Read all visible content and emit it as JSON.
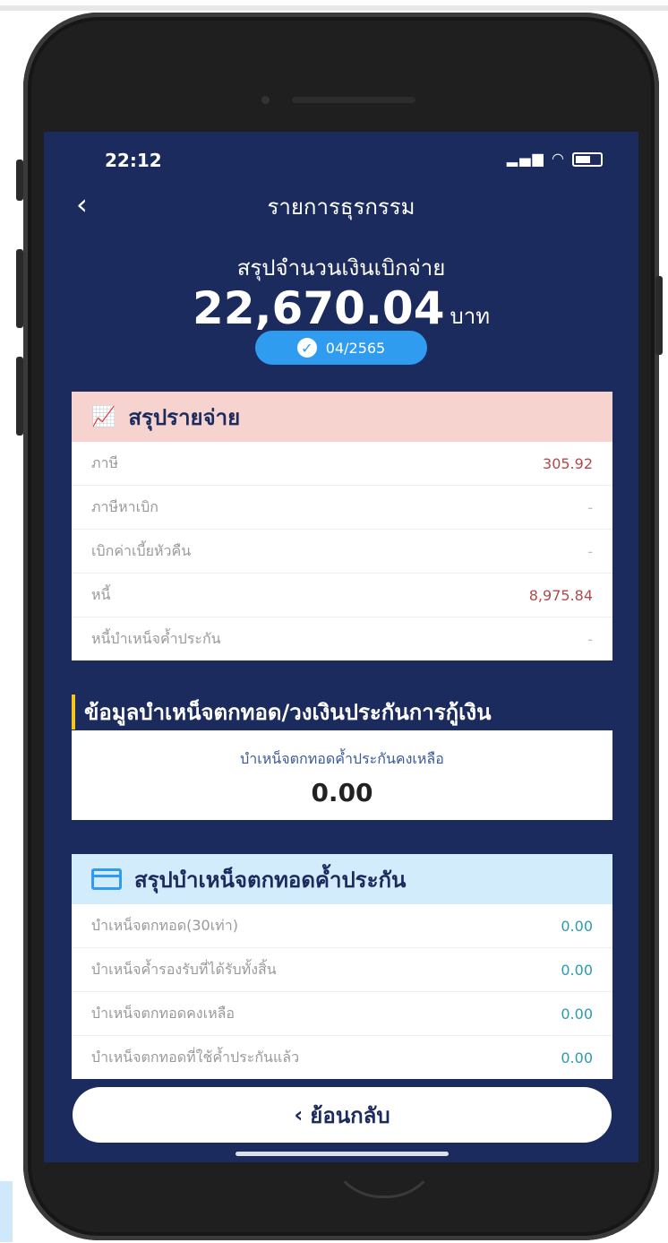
{
  "status_bar": {
    "time": "22:12",
    "icons": "signal wifi battery"
  },
  "header": {
    "title": "รายการธุรกรรม"
  },
  "summary": {
    "label": "สรุปจำนวนเงินเบิกจ่าย",
    "amount": "22,670.04",
    "unit": "บาท",
    "period": "04/2565"
  },
  "expense_card": {
    "title": "สรุปรายจ่าย",
    "icon": "chart-icon",
    "rows": [
      {
        "label": "ภาษี",
        "value": "305.92"
      },
      {
        "label": "ภาษีหาเบิก",
        "value": "-"
      },
      {
        "label": "เบิกค่าเบี้ยหัวคืน",
        "value": "-"
      },
      {
        "label": "หนี้",
        "value": "8,975.84"
      },
      {
        "label": "หนี้บำเหน็จค้ำประกัน",
        "value": "-"
      }
    ]
  },
  "section": {
    "title": "ข้อมูลบำเหน็จตกทอด/วงเงินประกันการกู้เงิน"
  },
  "balance": {
    "label": "บำเหน็จตกทอดค้ำประกันคงเหลือ",
    "value": "0.00"
  },
  "pension_card": {
    "title": "สรุปบำเหน็จตกทอดค้ำประกัน",
    "icon": "card-icon",
    "rows": [
      {
        "label": "บำเหน็จตกทอด(30เท่า)",
        "value": "0.00"
      },
      {
        "label": "บำเหน็จค้ำรองรับที่ได้รับทั้งสิ้น",
        "value": "0.00"
      },
      {
        "label": "บำเหน็จตกทอดคงเหลือ",
        "value": "0.00"
      },
      {
        "label": "บำเหน็จตกทอดที่ใช้ค้ำประกันแล้ว",
        "value": "0.00"
      }
    ]
  },
  "back_button": {
    "label": "ย้อนกลับ"
  },
  "colors": {
    "screen_bg": "#1b2b5d",
    "accent_blue": "#2f9cf0",
    "expense_header": "#f6d3cf",
    "pension_header": "#d3ecfb"
  }
}
